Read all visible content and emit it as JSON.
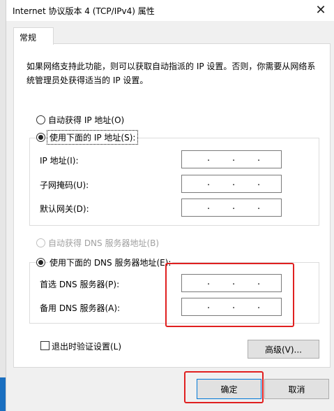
{
  "window": {
    "title": "Internet 协议版本 4 (TCP/IPv4) 属性",
    "close_glyph": "✕"
  },
  "tab": {
    "label": "常规"
  },
  "description": "如果网络支持此功能，则可以获取自动指派的 IP 设置。否则，你需要从网络系统管理员处获得适当的 IP 设置。",
  "ip_section": {
    "auto_label": "自动获得 IP 地址(O)",
    "manual_label": "使用下面的 IP 地址(S):",
    "ip_label": "IP 地址(I):",
    "mask_label": "子网掩码(U):",
    "gateway_label": "默认网关(D):"
  },
  "dns_section": {
    "auto_label": "自动获得 DNS 服务器地址(B)",
    "manual_label": "使用下面的 DNS 服务器地址(E):",
    "preferred_label": "首选 DNS 服务器(P):",
    "alternate_label": "备用 DNS 服务器(A):"
  },
  "validate_label": "退出时验证设置(L)",
  "advanced_label": "高级(V)...",
  "ok_label": "确定",
  "cancel_label": "取消",
  "ip_dot": "."
}
